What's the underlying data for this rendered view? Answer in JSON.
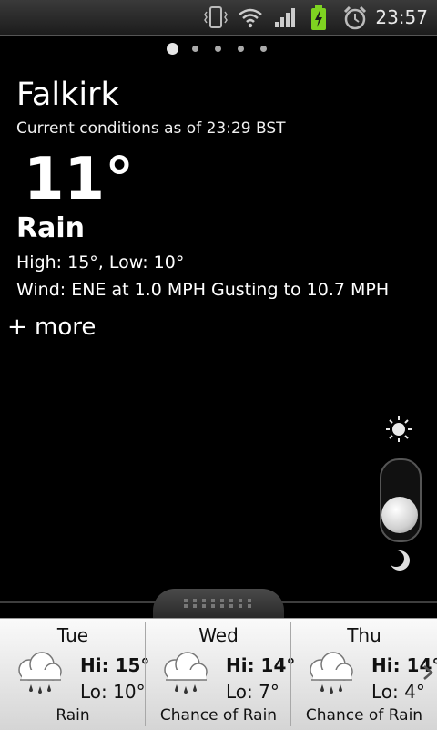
{
  "status_bar": {
    "time": "23:57",
    "icons": [
      "vibrate-icon",
      "wifi-icon",
      "signal-icon",
      "battery-charging-icon",
      "alarm-icon"
    ],
    "battery_color": "#7ed321"
  },
  "pager": {
    "pages": 5,
    "active": 1
  },
  "weather": {
    "city": "Falkirk",
    "as_of": "Current conditions as of 23:29 BST",
    "temperature": "11°",
    "condition": "Rain",
    "high_low": "High: 15°, Low: 10°",
    "wind": "Wind: ENE at 1.0 MPH Gusting to 10.7 MPH",
    "more_label": "+ more"
  },
  "brightness": {
    "top_icon": "sun-icon",
    "bottom_icon": "moon-icon"
  },
  "forecast": [
    {
      "day": "Tue",
      "hi": "Hi: 15°",
      "lo": "Lo: 10°",
      "condition": "Rain",
      "icon": "rain-cloud-icon"
    },
    {
      "day": "Wed",
      "hi": "Hi: 14°",
      "lo": "Lo: 7°",
      "condition": "Chance of Rain",
      "icon": "rain-cloud-icon"
    },
    {
      "day": "Thu",
      "hi": "Hi: 14°",
      "lo": "Lo: 4°",
      "condition": "Chance of Rain",
      "icon": "rain-cloud-icon"
    }
  ]
}
